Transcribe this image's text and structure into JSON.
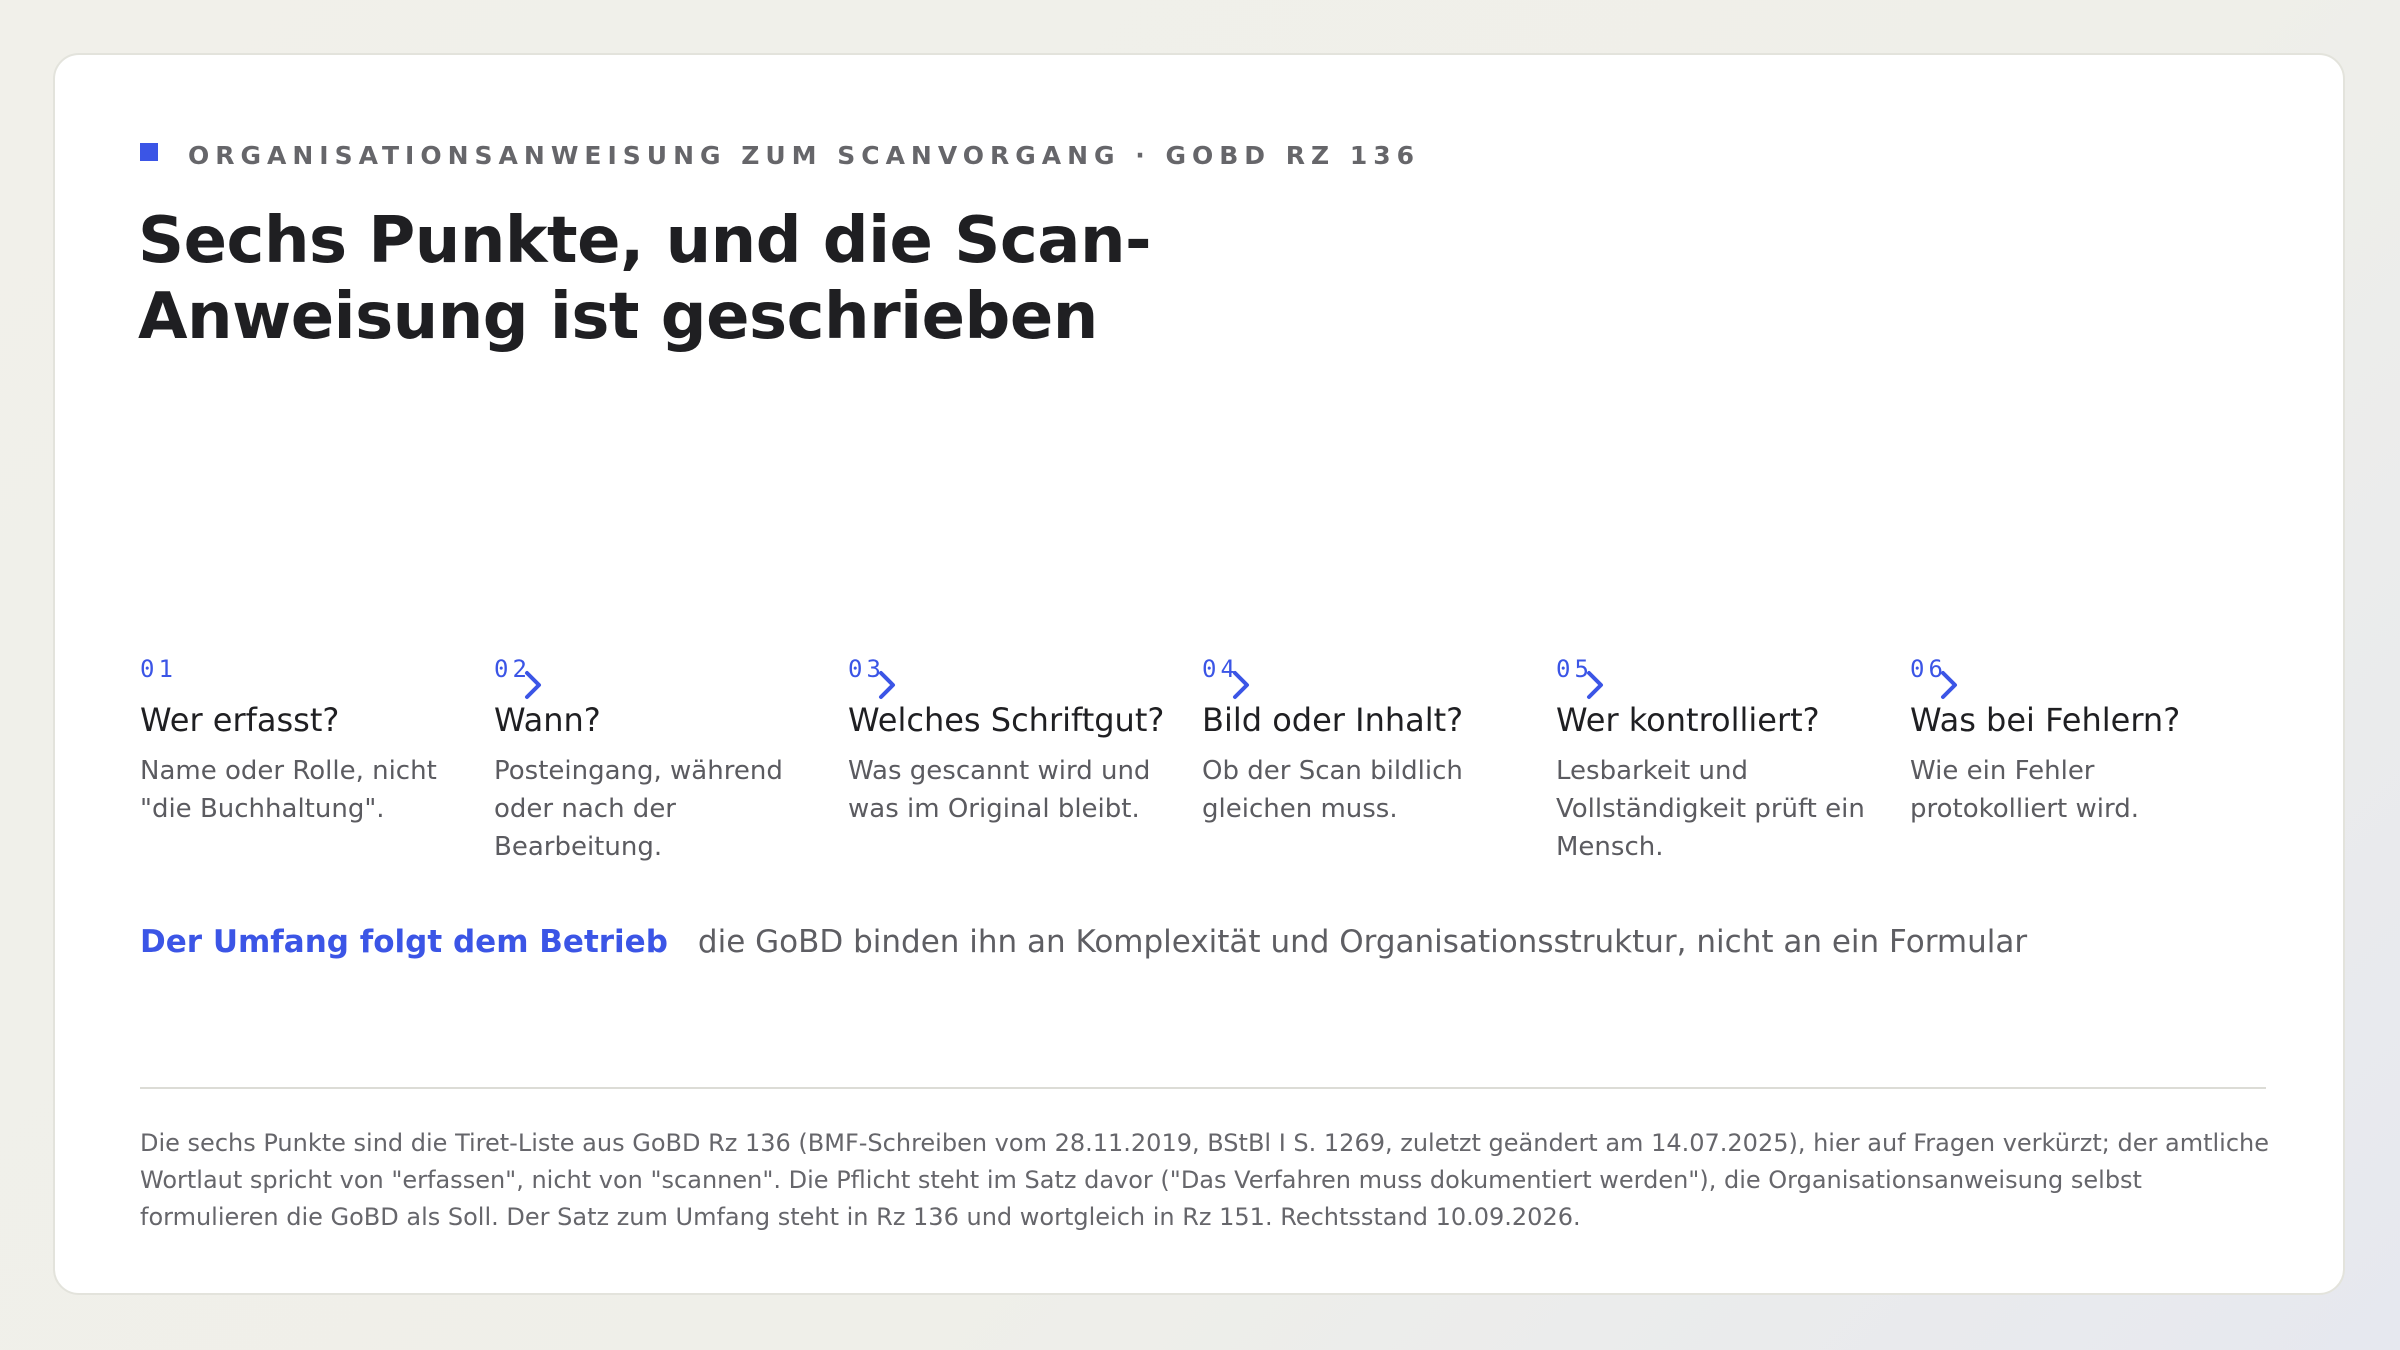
{
  "eyebrow": "ORGANISATIONSANWEISUNG ZUM SCANVORGANG · GOBD RZ 136",
  "title": "Sechs Punkte, und die Scan-Anweisung ist geschrieben",
  "accent_color": "#3b55e6",
  "steps": [
    {
      "num": "01",
      "question": "Wer erfasst?",
      "description": "Name oder Rolle, nicht \"die Buchhaltung\"."
    },
    {
      "num": "02",
      "question": "Wann?",
      "description": "Posteingang, während oder nach der Bearbeitung."
    },
    {
      "num": "03",
      "question": "Welches Schriftgut?",
      "description": "Was gescannt wird und was im Original bleibt."
    },
    {
      "num": "04",
      "question": "Bild oder Inhalt?",
      "description": "Ob der Scan bildlich gleichen muss."
    },
    {
      "num": "05",
      "question": "Wer kontrolliert?",
      "description": "Lesbarkeit und Vollständigkeit prüft ein Mensch."
    },
    {
      "num": "06",
      "question": "Was bei Fehlern?",
      "description": "Wie ein Fehler protokolliert wird."
    }
  ],
  "separator_icon": "chevron-right-icon",
  "scope": {
    "lead": "Der Umfang folgt dem Betrieb",
    "text": "die GoBD binden ihn an Komplexität und Organisationsstruktur, nicht an ein Formular"
  },
  "footnote": "Die sechs Punkte sind die Tiret-Liste aus GoBD Rz 136 (BMF-Schreiben vom 28.11.2019, BStBl I S. 1269, zuletzt geändert am 14.07.2025), hier auf Fragen verkürzt; der amtliche Wortlaut spricht von \"erfassen\", nicht von \"scannen\". Die Pflicht steht im Satz davor (\"Das Verfahren muss dokumentiert werden\"), die Organisationsanweisung selbst formulieren die GoBD als Soll. Der Satz zum Umfang steht in Rz 136 und wortgleich in Rz 151. Rechtsstand 10.09.2026."
}
